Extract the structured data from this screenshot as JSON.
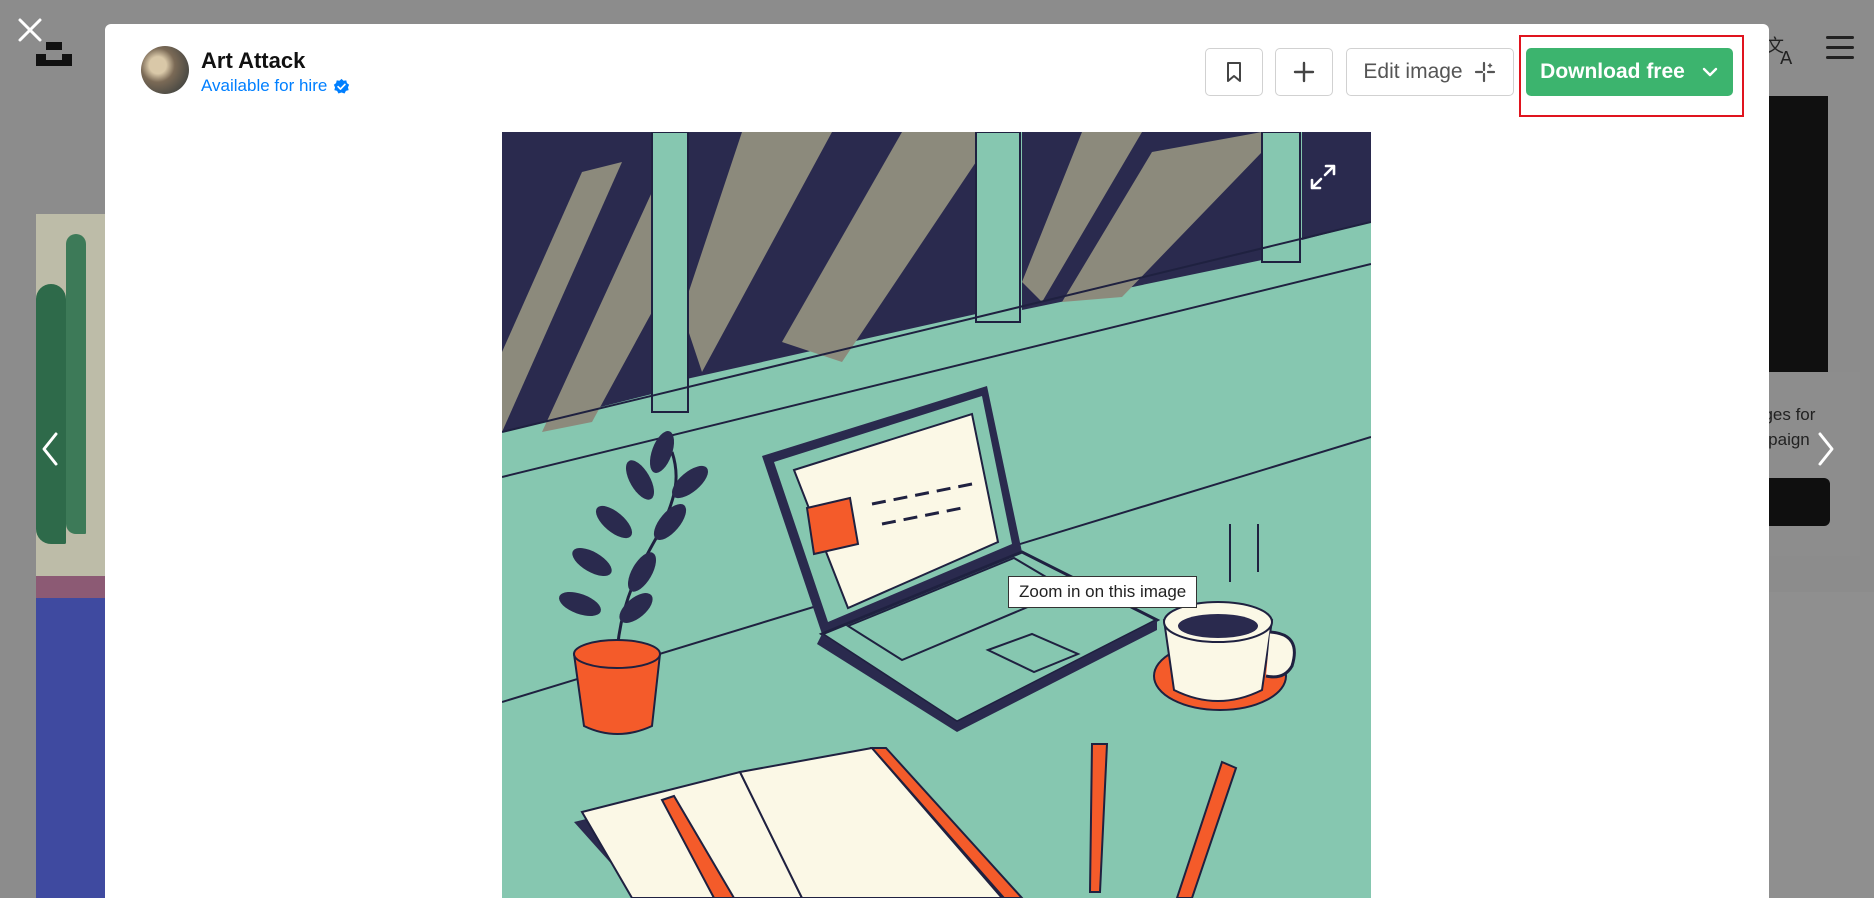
{
  "modal": {
    "author": {
      "name": "Art Attack",
      "hire_label": "Available for hire"
    },
    "actions": {
      "edit_label": "Edit image",
      "download_label": "Download free"
    },
    "image": {
      "tooltip": "Zoom in on this image"
    }
  },
  "background": {
    "right_card_text": "ages for mpaign"
  },
  "icons": [
    "close-icon",
    "unsplash-logo-icon",
    "translate-icon",
    "menu-icon",
    "chevron-left-icon",
    "chevron-right-icon",
    "verified-icon",
    "bookmark-icon",
    "plus-icon",
    "sparkle-icon",
    "chevron-down-icon",
    "expand-icon"
  ],
  "colors": {
    "download_green": "#3cb46e",
    "link_blue": "#007fff",
    "highlight_red": "#e0141e",
    "illustration_teal": "#86c7b0",
    "illustration_orange": "#f45b2a",
    "illustration_navy": "#2a2a4e"
  }
}
